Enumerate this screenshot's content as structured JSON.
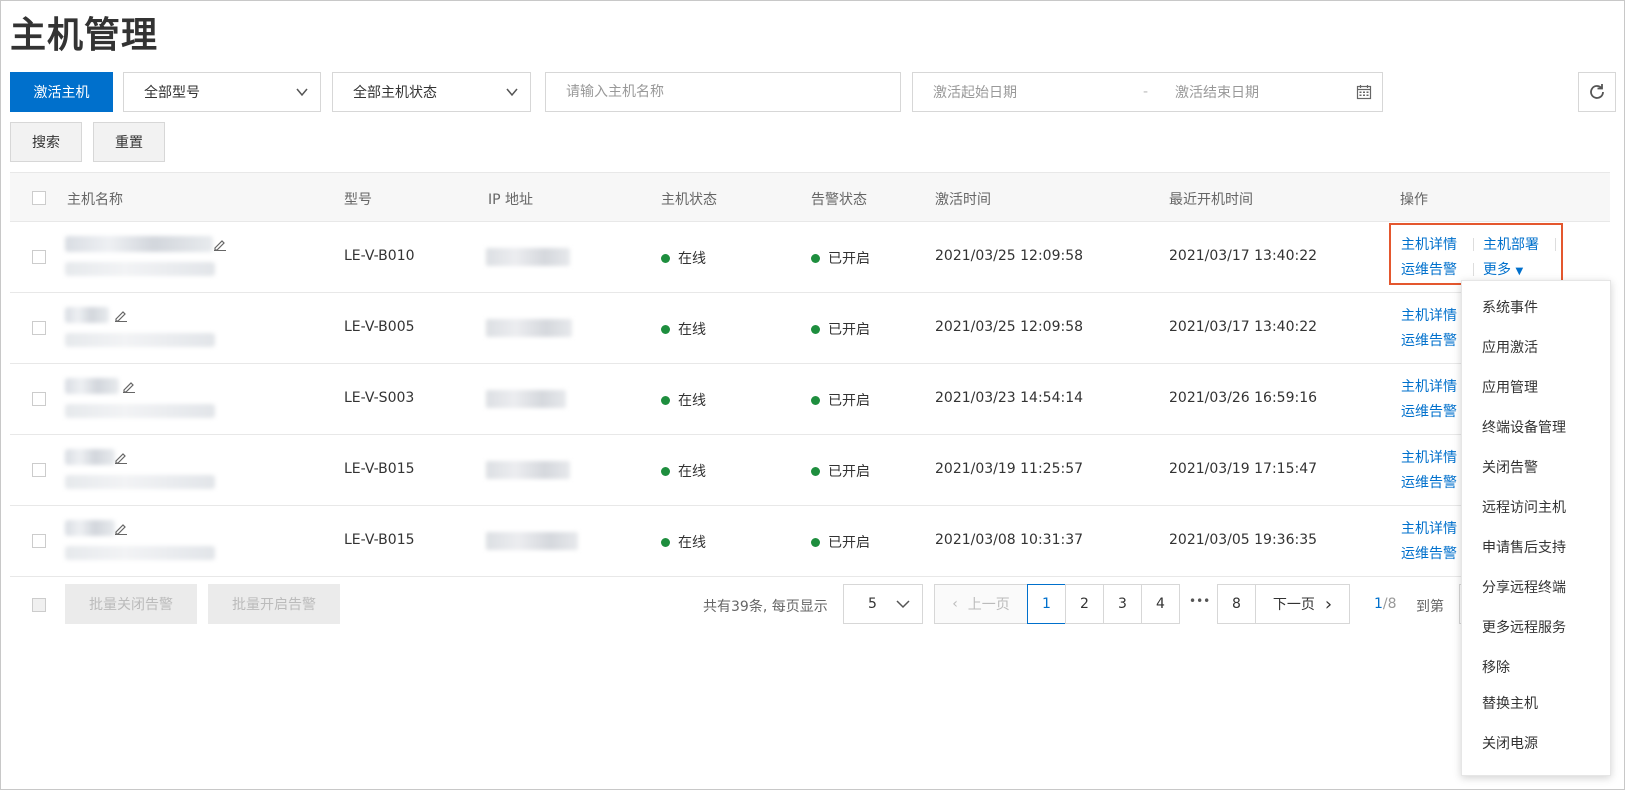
{
  "page_title": "主机管理",
  "toolbar": {
    "activate_button": "激活主机",
    "model_select": "全部型号",
    "status_select": "全部主机状态",
    "search_placeholder": "请输入主机名称",
    "date_start_placeholder": "激活起始日期",
    "date_separator": "-",
    "date_end_placeholder": "激活结束日期",
    "search_button": "搜索",
    "reset_button": "重置"
  },
  "table": {
    "columns": [
      "主机名称",
      "型号",
      "IP 地址",
      "主机状态",
      "告警状态",
      "激活时间",
      "最近开机时间",
      "操作"
    ],
    "rows": [
      {
        "model": "LE-V-B010",
        "status": "在线",
        "alert": "已开启",
        "activated": "2021/03/25 12:09:58",
        "last_boot": "2021/03/17 13:40:22"
      },
      {
        "model": "LE-V-B005",
        "status": "在线",
        "alert": "已开启",
        "activated": "2021/03/25 12:09:58",
        "last_boot": "2021/03/17 13:40:22"
      },
      {
        "model": "LE-V-S003",
        "status": "在线",
        "alert": "已开启",
        "activated": "2021/03/23 14:54:14",
        "last_boot": "2021/03/26 16:59:16"
      },
      {
        "model": "LE-V-B015",
        "status": "在线",
        "alert": "已开启",
        "activated": "2021/03/19 11:25:57",
        "last_boot": "2021/03/19 17:15:47"
      },
      {
        "model": "LE-V-B015",
        "status": "在线",
        "alert": "已开启",
        "activated": "2021/03/08 10:31:37",
        "last_boot": "2021/03/05 19:36:35"
      }
    ],
    "actions": {
      "detail": "主机详情",
      "deploy": "主机部署",
      "ops_alert": "运维告警",
      "more": "更多"
    }
  },
  "more_menu": [
    "系统事件",
    "应用激活",
    "应用管理",
    "终端设备管理",
    "关闭告警",
    "远程访问主机",
    "申请售后支持",
    "分享远程终端",
    "更多远程服务",
    "移除",
    "替换主机",
    "关闭电源"
  ],
  "footer": {
    "batch_close_alert": "批量关闭告警",
    "batch_open_alert": "批量开启告警",
    "total_text": "共有39条, 每页显示",
    "page_size": "5",
    "prev": "上一页",
    "pages": [
      "1",
      "2",
      "3",
      "4"
    ],
    "ellipsis": "•••",
    "last_page": "8",
    "next": "下一页",
    "current_page": "1",
    "total_pages": "/8",
    "goto": "到第"
  },
  "colors": {
    "primary": "#0070cc",
    "online_dot": "#1e8e3e",
    "highlight": "#e4572e"
  }
}
